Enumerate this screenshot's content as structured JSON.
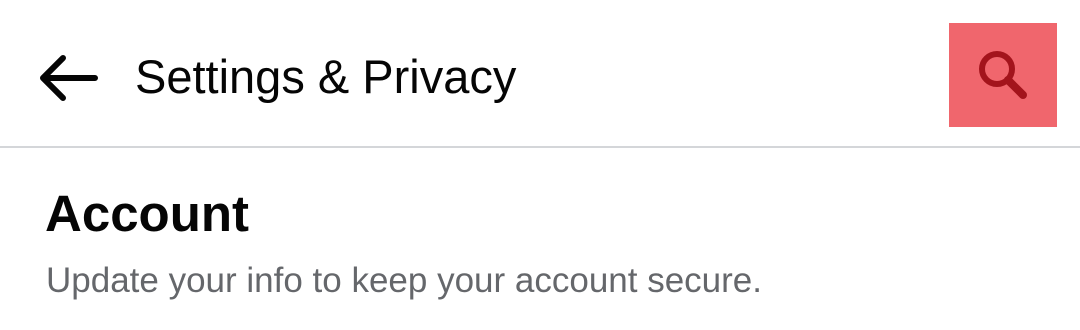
{
  "header": {
    "title": "Settings & Privacy",
    "back_icon": "arrow-left-icon",
    "search_icon": "search-icon",
    "search_highlight_color": "#f0666d",
    "search_icon_color": "#a3141c"
  },
  "section": {
    "title": "Account",
    "subtitle": "Update your info to keep your account secure."
  }
}
